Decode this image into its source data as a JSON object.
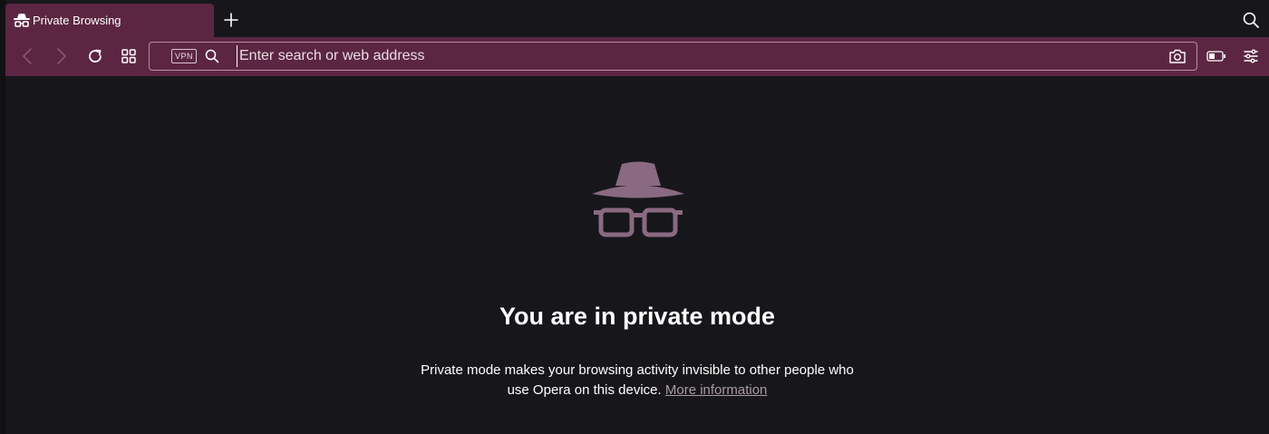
{
  "tab": {
    "title": "Private Browsing"
  },
  "toolbar": {
    "vpn_label": "VPN",
    "address_placeholder": "Enter search or web address"
  },
  "content": {
    "heading": "You are in private mode",
    "description": "Private mode makes your browsing activity invisible to other people who use Opera on this device.",
    "link_text": "More information"
  },
  "colors": {
    "accent": "#5c2642",
    "background": "#17171b",
    "icon": "#8a6a80"
  },
  "icons": {
    "tab": "incognito-icon",
    "new_tab": "plus-icon",
    "tab_search": "search-icon",
    "back": "chevron-left-icon",
    "forward": "chevron-right-icon",
    "reload": "reload-icon",
    "tabs_grid": "grid-icon",
    "address_search": "search-icon",
    "snapshot": "camera-icon",
    "battery": "battery-icon",
    "easy_setup": "sliders-icon",
    "hero": "incognito-icon"
  }
}
